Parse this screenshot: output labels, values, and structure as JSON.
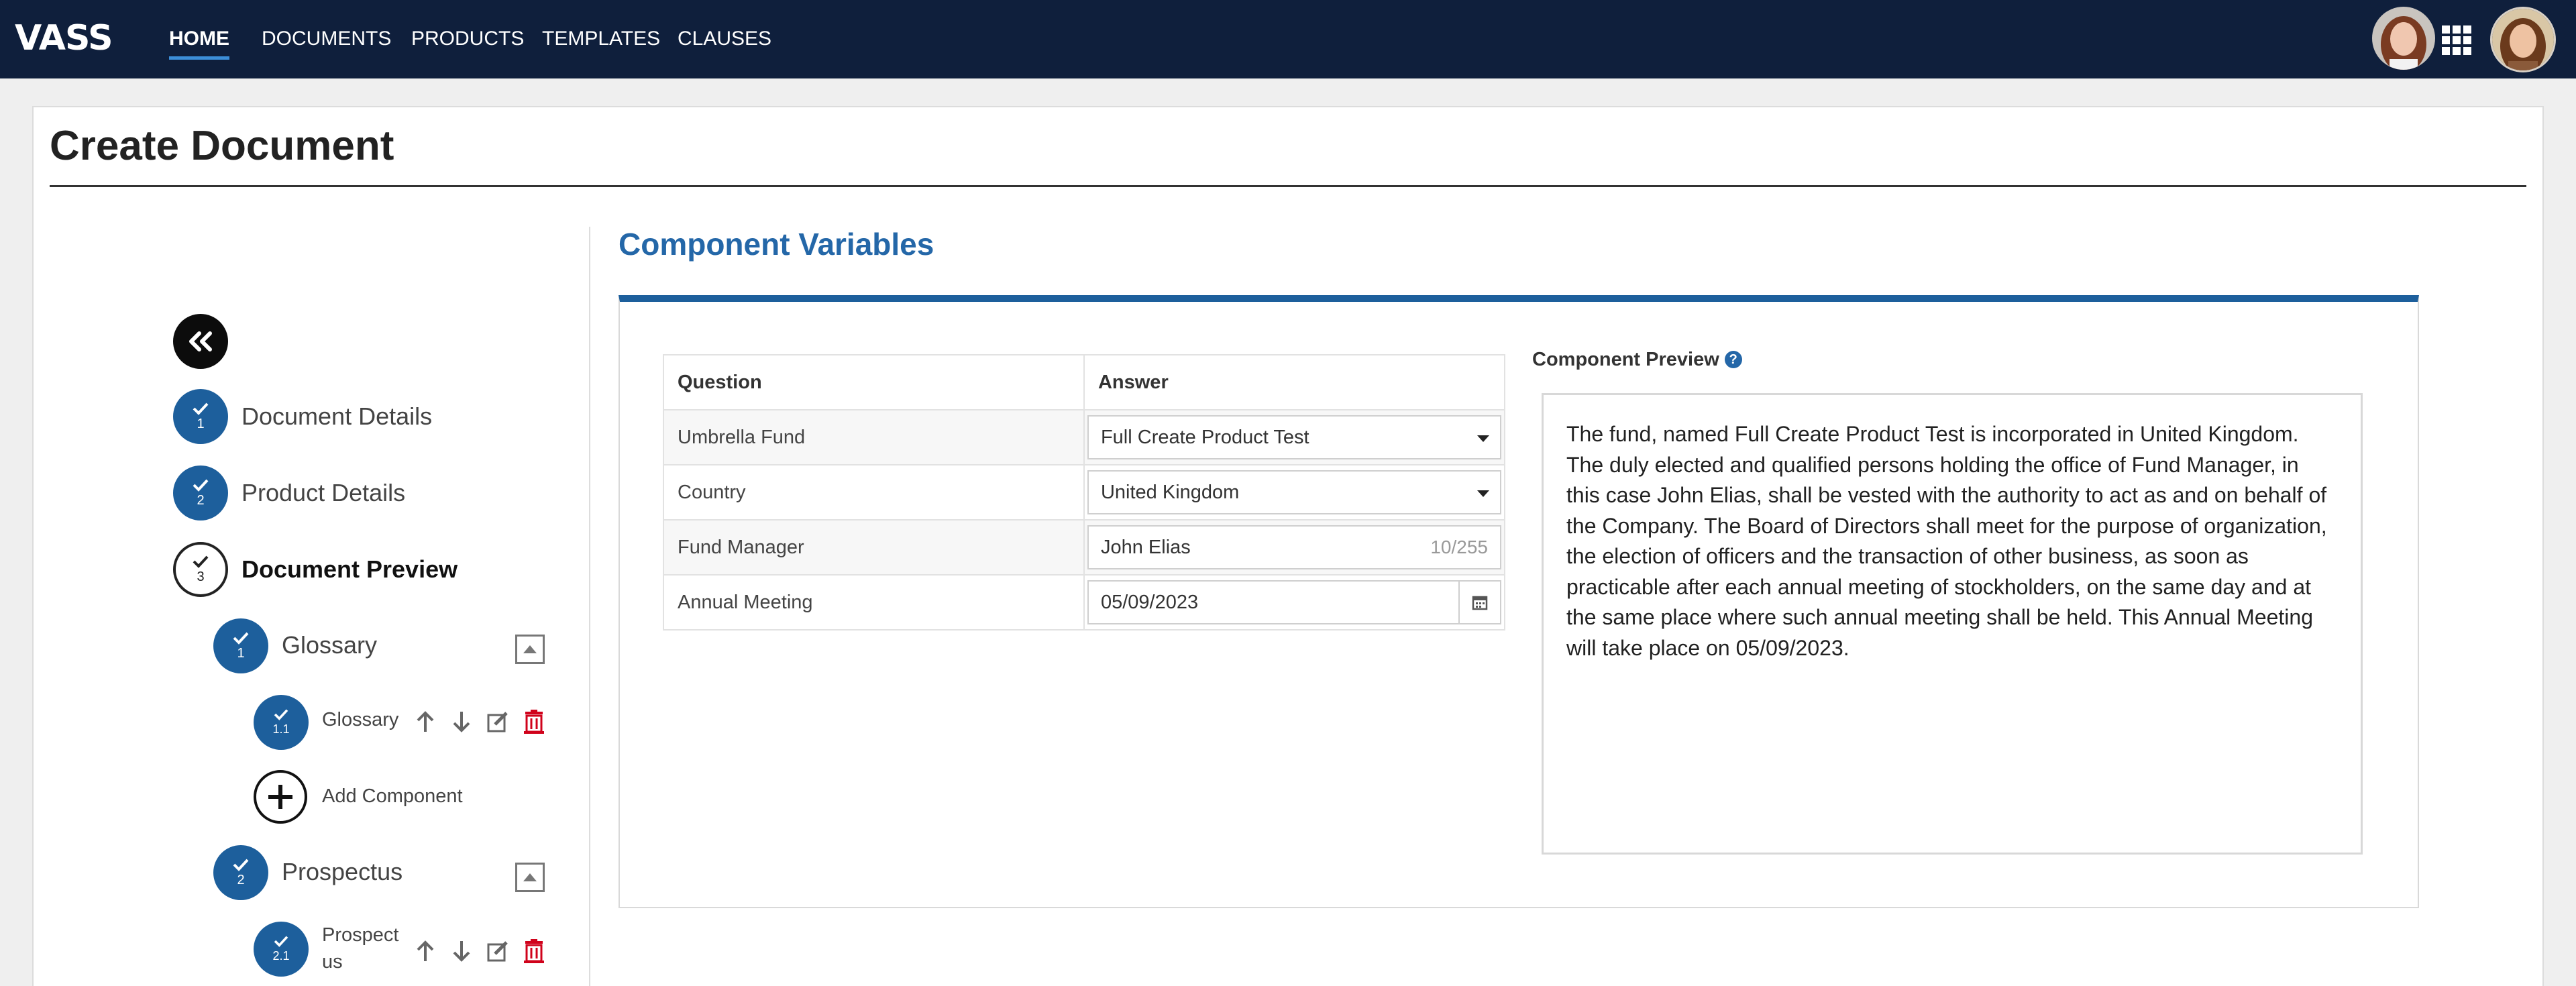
{
  "header": {
    "logo": "VASS",
    "nav": [
      "HOME",
      "DOCUMENTS",
      "PRODUCTS",
      "TEMPLATES",
      "CLAUSES"
    ],
    "active_nav": "HOME",
    "colors": {
      "bar": "#0f1f3c",
      "active_underline": "#3c8ed8"
    }
  },
  "page": {
    "title": "Create Document"
  },
  "stepper": {
    "steps": [
      {
        "number": "1",
        "label": "Document Details",
        "status": "complete"
      },
      {
        "number": "2",
        "label": "Product Details",
        "status": "complete"
      },
      {
        "number": "3",
        "label": "Document Preview",
        "status": "current"
      }
    ],
    "sections": [
      {
        "number": "1",
        "label": "Glossary",
        "components": [
          {
            "number": "1.1",
            "label": "Glossary"
          }
        ]
      },
      {
        "number": "2",
        "label": "Prospectus",
        "components": [
          {
            "number": "2.1",
            "label_line1": "Prospect",
            "label_line2": "us"
          }
        ]
      }
    ],
    "add_component_label": "Add Component",
    "colors": {
      "step": "#1d5f9c",
      "delete": "#d0021b"
    }
  },
  "main": {
    "section_title": "Component Variables",
    "table": {
      "headers": [
        "Question",
        "Answer"
      ],
      "rows": [
        {
          "question": "Umbrella Fund",
          "answer": "Full Create Product Test",
          "type": "select"
        },
        {
          "question": "Country",
          "answer": "United Kingdom",
          "type": "select"
        },
        {
          "question": "Fund Manager",
          "answer": "John Elias",
          "counter": "10/255",
          "type": "text"
        },
        {
          "question": "Annual Meeting",
          "answer": "05/09/2023",
          "type": "date"
        }
      ]
    },
    "preview": {
      "label": "Component Preview",
      "text": "The fund, named Full Create Product Test is incorporated in United Kingdom. The duly elected and qualified persons holding the office of Fund Manager, in this case John Elias, shall be vested with the authority to act as and on behalf of the Company. The Board of Directors shall meet for the purpose of organization, the election of officers and the transaction of other business, as soon as practicable after each annual meeting of stockholders, on the same day and at the same place where such annual meeting shall be held. This Annual Meeting will take place on 05/09/2023."
    },
    "colors": {
      "accent": "#1d5f9c",
      "title": "#2467a8"
    }
  }
}
